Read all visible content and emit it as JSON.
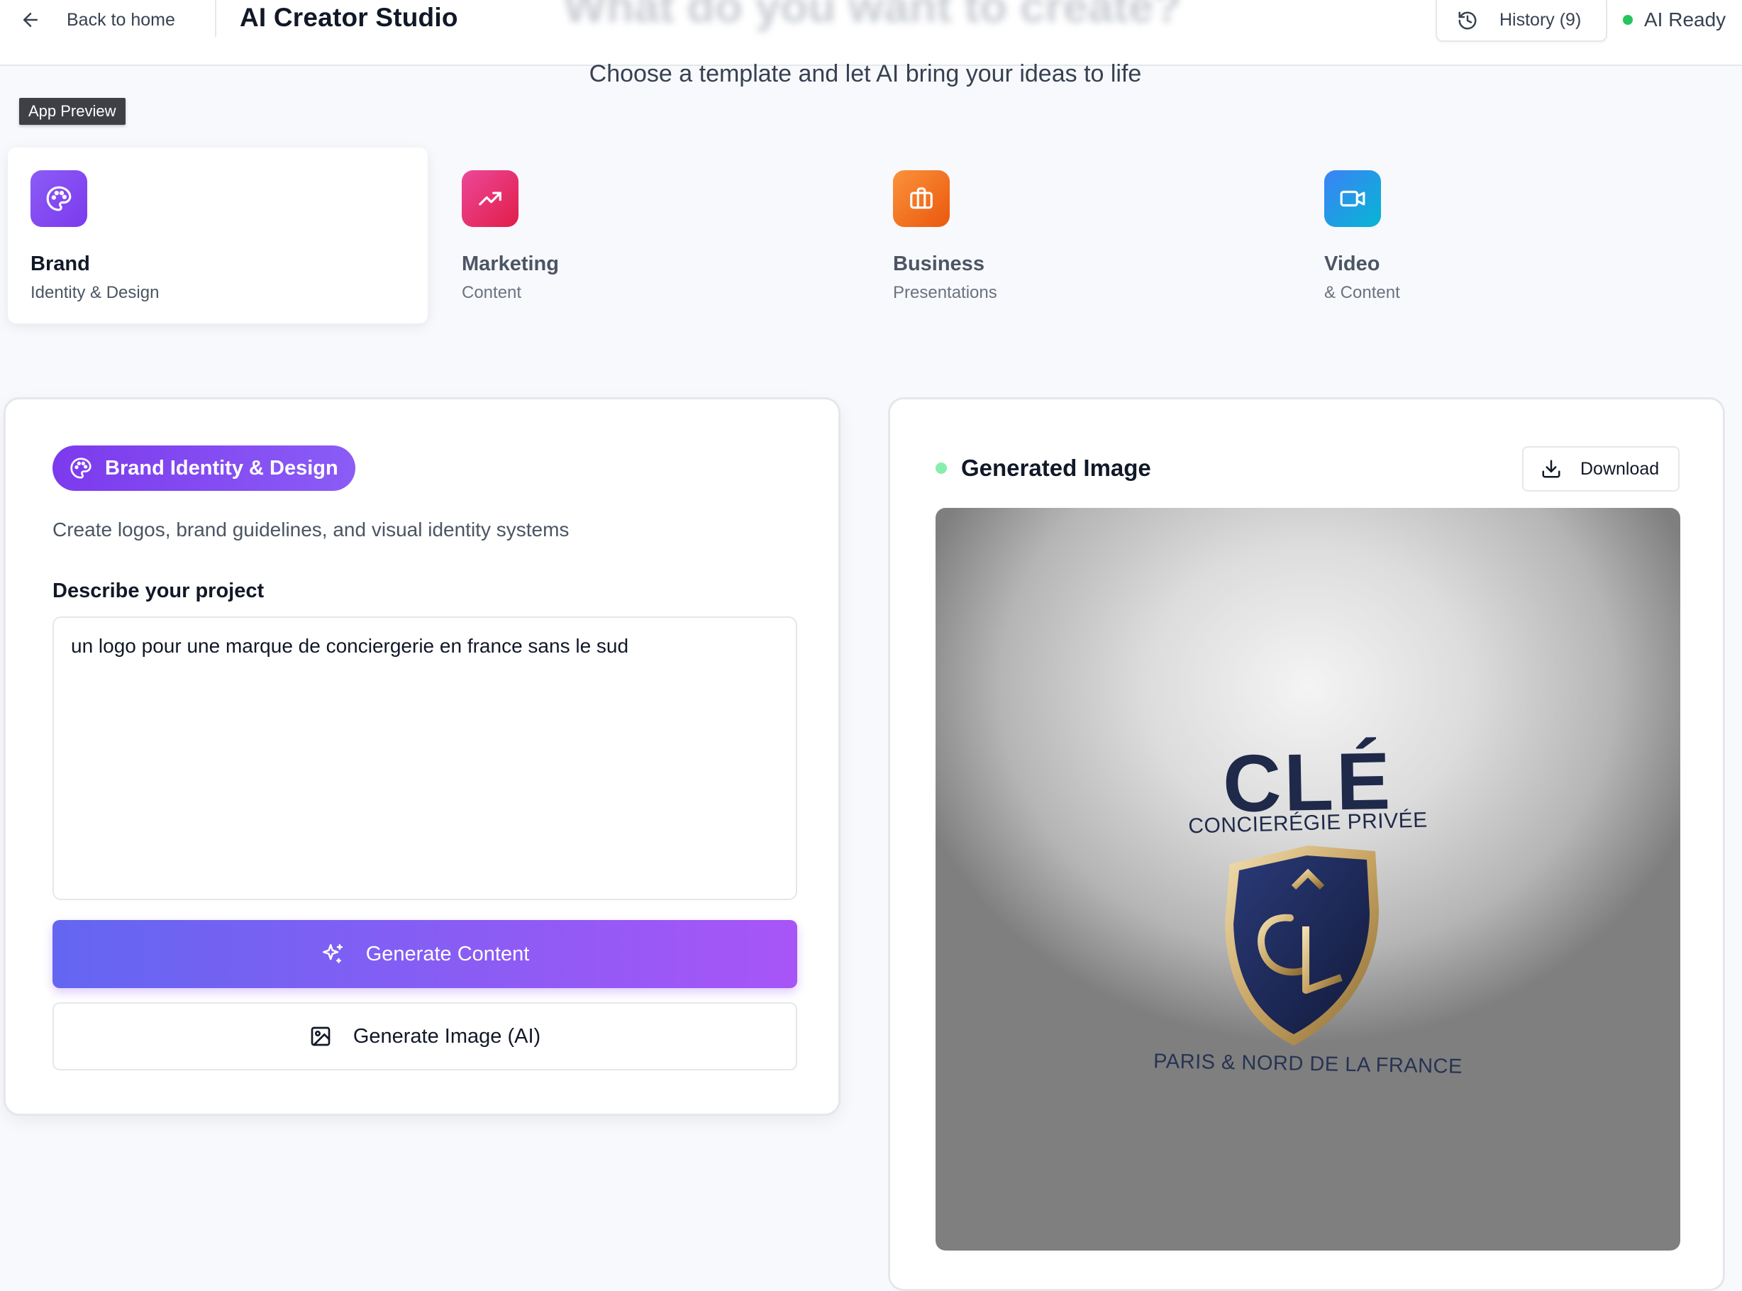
{
  "header": {
    "back_label": "Back to home",
    "app_title": "AI Creator Studio",
    "faded_heading": "What do you want to create?",
    "history_label": "History (9)",
    "status_label": "AI Ready"
  },
  "subtitle": "Choose a template and let AI bring your ideas to life",
  "preview_badge": "App Preview",
  "templates": [
    {
      "title": "Brand",
      "subtitle": "Identity & Design",
      "icon": "palette-icon",
      "color": "#8b5cf6",
      "active": true
    },
    {
      "title": "Marketing",
      "subtitle": "Content",
      "icon": "trending-up-icon",
      "color": "#ec4899",
      "active": false
    },
    {
      "title": "Business",
      "subtitle": "Presentations",
      "icon": "briefcase-icon",
      "color": "#f97316",
      "active": false
    },
    {
      "title": "Video",
      "subtitle": "& Content",
      "icon": "video-icon",
      "color": "#3b82f6",
      "active": false
    }
  ],
  "editor": {
    "pill_label": "Brand Identity & Design",
    "description": "Create logos, brand guidelines, and visual identity systems",
    "field_label": "Describe your project",
    "prompt_value": "un logo pour une marque de conciergerie en france sans le sud",
    "generate_content_label": "Generate Content",
    "generate_image_label": "Generate Image (AI)"
  },
  "output": {
    "title": "Generated Image",
    "download_label": "Download",
    "logo": {
      "brand": "CLÉ",
      "tagline": "CONCIERÉGIE PRIVÉE",
      "location": "PARIS & NORD DE LA FRANCE"
    }
  },
  "colors": {
    "accent_start": "#6366f1",
    "accent_end": "#a855f7",
    "status_green": "#22c55e"
  }
}
